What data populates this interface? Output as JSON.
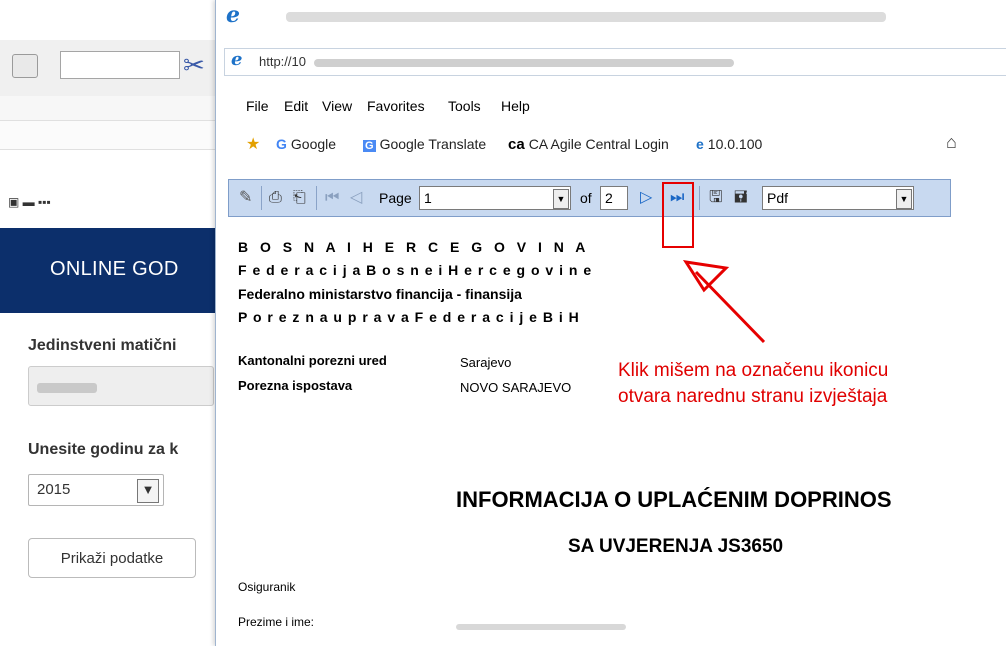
{
  "background_page": {
    "banner_title": "ONLINE GOD",
    "label_jmbg": "Jedinstveni matični",
    "label_year": "Unesite godinu za k",
    "year_value": "2015",
    "show_button": "Prikaži podatke"
  },
  "popup": {
    "address_prefix": "http://10",
    "menu": [
      "File",
      "Edit",
      "View",
      "Favorites",
      "Tools",
      "Help"
    ],
    "favorites": [
      "Google",
      "Google Translate",
      "CA Agile Central Login",
      "10.0.100"
    ]
  },
  "report_toolbar": {
    "page_label": "Page",
    "page_value": "1",
    "of_label": "of",
    "total_pages": "2",
    "format_value": "Pdf"
  },
  "report": {
    "line1": "B O S N A   I   H E R C E G O V I N A",
    "line2": "F e d e r a c i j a  B o s n e  i  H e r c e g o v i n e",
    "line3": "Federalno  ministarstvo  financija  -  finansija",
    "line4": "P o r e z n a   u p r a v a   F e d e r a c i j e  B i H",
    "kantonalni_label": "Kantonalni porezni ured",
    "kantonalni_value": "Sarajevo",
    "ispostava_label": "Porezna ispostava",
    "ispostava_value": "NOVO SARAJEVO",
    "title": "INFORMACIJA O UPLAĆENIM DOPRINOS",
    "subtitle": "SA UVJERENJA JS3650",
    "osiguranik_label": "Osiguranik",
    "prezime_label": "Prezime i ime:"
  },
  "annotation": {
    "line1": "Klik mišem na označenu ikonicu",
    "line2": "otvara narednu stranu izvještaja",
    "color": "#e00000"
  }
}
